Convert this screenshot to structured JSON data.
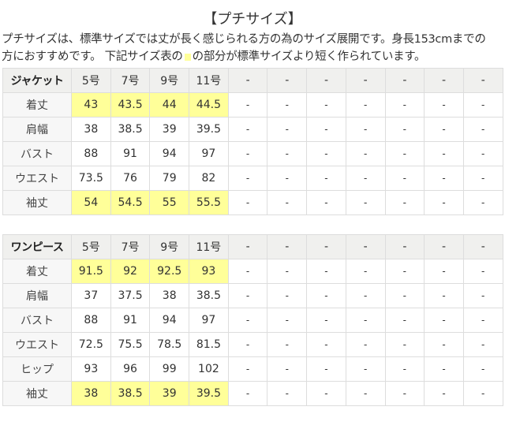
{
  "title": "【プチサイズ】",
  "description": {
    "line1": "プチサイズは、標準サイズでは丈が長く感じられる方の為のサイズ展開です。身長153cmまでの",
    "line2_before": "方におすすめです。 下記サイズ表の",
    "line2_after": "の部分が標準サイズより短く作られています。",
    "highlight_color": "#ffff99"
  },
  "colors": {
    "header_bg": "#f0f0ee",
    "label_bg": "#f7f7f7",
    "highlight": "#ffff99",
    "border": "#dddddd",
    "text": "#333333"
  },
  "tables": [
    {
      "category": "ジャケット",
      "sizes": [
        "5号",
        "7号",
        "9号",
        "11号",
        "-",
        "-",
        "-",
        "-",
        "-",
        "-",
        "-"
      ],
      "rows": [
        {
          "label": "着丈",
          "highlighted": true,
          "values": [
            "43",
            "43.5",
            "44",
            "44.5",
            "-",
            "-",
            "-",
            "-",
            "-",
            "-",
            "-"
          ]
        },
        {
          "label": "肩幅",
          "highlighted": false,
          "values": [
            "38",
            "38.5",
            "39",
            "39.5",
            "-",
            "-",
            "-",
            "-",
            "-",
            "-",
            "-"
          ]
        },
        {
          "label": "バスト",
          "highlighted": false,
          "values": [
            "88",
            "91",
            "94",
            "97",
            "-",
            "-",
            "-",
            "-",
            "-",
            "-",
            "-"
          ]
        },
        {
          "label": "ウエスト",
          "highlighted": false,
          "values": [
            "73.5",
            "76",
            "79",
            "82",
            "-",
            "-",
            "-",
            "-",
            "-",
            "-",
            "-"
          ]
        },
        {
          "label": "袖丈",
          "highlighted": true,
          "values": [
            "54",
            "54.5",
            "55",
            "55.5",
            "-",
            "-",
            "-",
            "-",
            "-",
            "-",
            "-"
          ]
        }
      ]
    },
    {
      "category": "ワンピース",
      "sizes": [
        "5号",
        "7号",
        "9号",
        "11号",
        "-",
        "-",
        "-",
        "-",
        "-",
        "-",
        "-"
      ],
      "rows": [
        {
          "label": "着丈",
          "highlighted": true,
          "values": [
            "91.5",
            "92",
            "92.5",
            "93",
            "-",
            "-",
            "-",
            "-",
            "-",
            "-",
            "-"
          ]
        },
        {
          "label": "肩幅",
          "highlighted": false,
          "values": [
            "37",
            "37.5",
            "38",
            "38.5",
            "-",
            "-",
            "-",
            "-",
            "-",
            "-",
            "-"
          ]
        },
        {
          "label": "バスト",
          "highlighted": false,
          "values": [
            "88",
            "91",
            "94",
            "97",
            "-",
            "-",
            "-",
            "-",
            "-",
            "-",
            "-"
          ]
        },
        {
          "label": "ウエスト",
          "highlighted": false,
          "values": [
            "72.5",
            "75.5",
            "78.5",
            "81.5",
            "-",
            "-",
            "-",
            "-",
            "-",
            "-",
            "-"
          ]
        },
        {
          "label": "ヒップ",
          "highlighted": false,
          "values": [
            "93",
            "96",
            "99",
            "102",
            "-",
            "-",
            "-",
            "-",
            "-",
            "-",
            "-"
          ]
        },
        {
          "label": "袖丈",
          "highlighted": true,
          "values": [
            "38",
            "38.5",
            "39",
            "39.5",
            "-",
            "-",
            "-",
            "-",
            "-",
            "-",
            "-"
          ]
        }
      ]
    }
  ]
}
